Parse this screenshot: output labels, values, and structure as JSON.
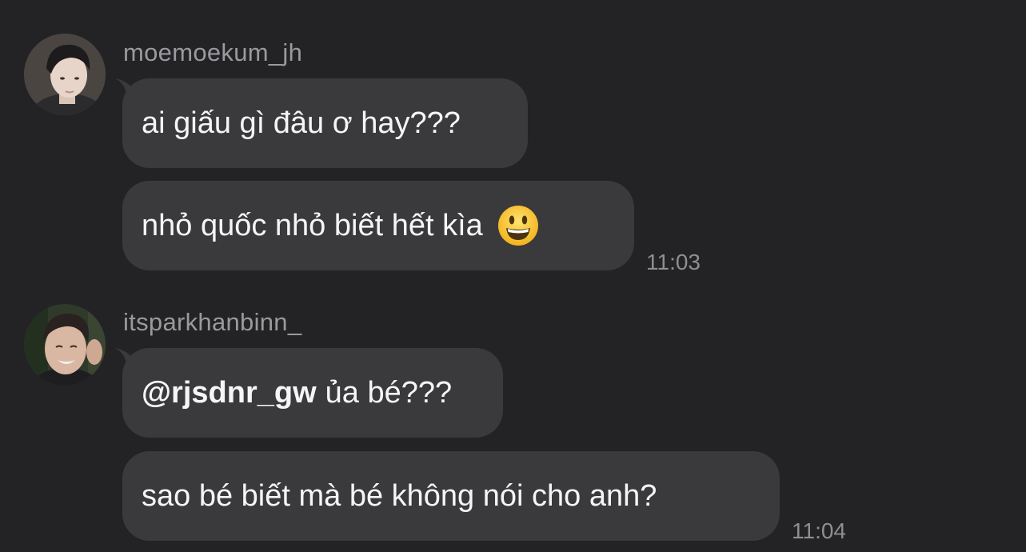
{
  "messages": [
    {
      "sender": "moemoekum_jh",
      "bubbles": [
        "ai giấu gì đâu ơ hay???",
        "nhỏ quốc nhỏ biết hết kìa"
      ],
      "emoji": "grinning-face-emoji",
      "timestamp": "11:03"
    },
    {
      "sender": "itsparkhanbinn_",
      "mention": "@rjsdnr_gw",
      "bubbles": [
        "ủa bé???",
        "sao bé biết mà bé không nói cho anh?"
      ],
      "timestamp": "11:04"
    }
  ],
  "colors": {
    "background": "#232325",
    "bubble": "#3a3a3c",
    "text": "#f5f5f7",
    "username": "#9a9a9e",
    "timestamp": "#8e8e93"
  }
}
